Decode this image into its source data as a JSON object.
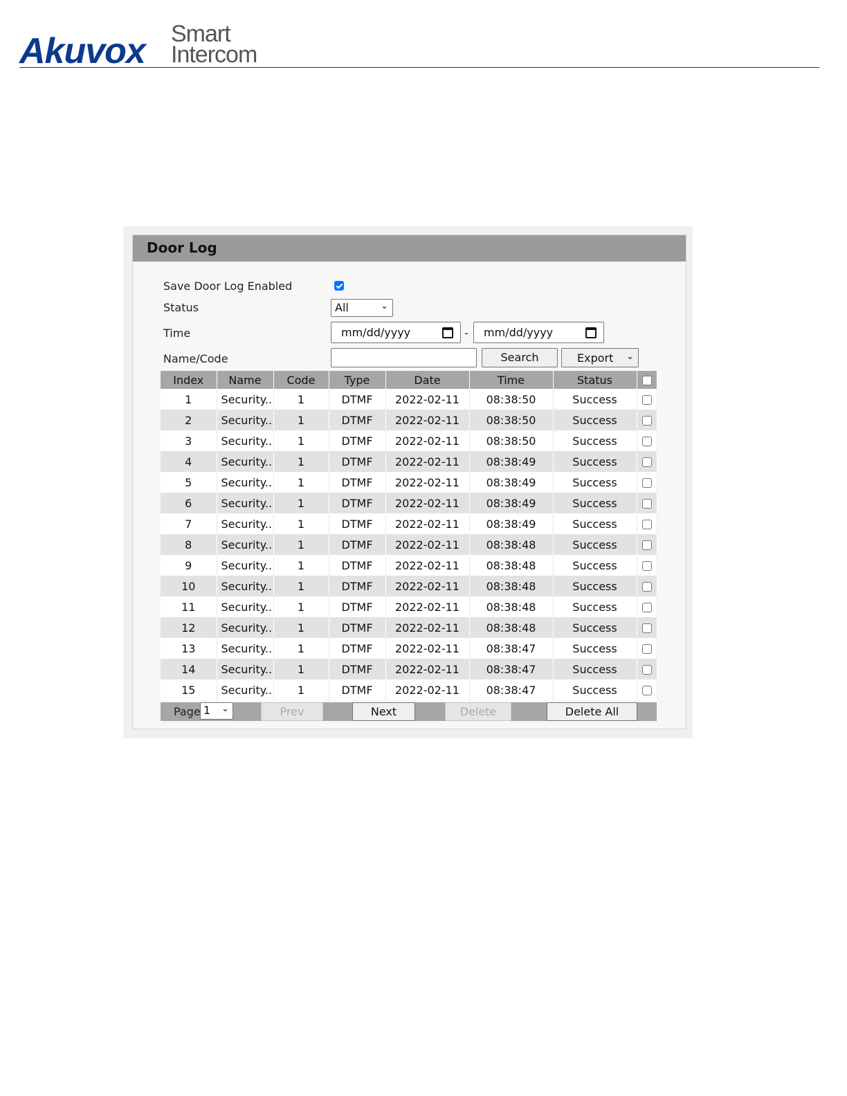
{
  "header": {
    "brand": "Akuvox",
    "tag_line1": "Smart",
    "tag_line2": "Intercom"
  },
  "panel": {
    "title": "Door Log"
  },
  "form": {
    "save_label": "Save Door Log Enabled",
    "save_checked": true,
    "status_label": "Status",
    "status_value": "All",
    "time_label": "Time",
    "date_from_placeholder": "mm/dd/yyyy",
    "date_separator": "-",
    "date_to_placeholder": "mm/dd/yyyy",
    "name_code_label": "Name/Code",
    "name_code_value": "",
    "search_label": "Search",
    "export_label": "Export"
  },
  "table": {
    "headers": [
      "Index",
      "Name",
      "Code",
      "Type",
      "Date",
      "Time",
      "Status"
    ],
    "rows": [
      {
        "index": "1",
        "name": "Security..",
        "code": "1",
        "type": "DTMF",
        "date": "2022-02-11",
        "time": "08:38:50",
        "status": "Success"
      },
      {
        "index": "2",
        "name": "Security..",
        "code": "1",
        "type": "DTMF",
        "date": "2022-02-11",
        "time": "08:38:50",
        "status": "Success"
      },
      {
        "index": "3",
        "name": "Security..",
        "code": "1",
        "type": "DTMF",
        "date": "2022-02-11",
        "time": "08:38:50",
        "status": "Success"
      },
      {
        "index": "4",
        "name": "Security..",
        "code": "1",
        "type": "DTMF",
        "date": "2022-02-11",
        "time": "08:38:49",
        "status": "Success"
      },
      {
        "index": "5",
        "name": "Security..",
        "code": "1",
        "type": "DTMF",
        "date": "2022-02-11",
        "time": "08:38:49",
        "status": "Success"
      },
      {
        "index": "6",
        "name": "Security..",
        "code": "1",
        "type": "DTMF",
        "date": "2022-02-11",
        "time": "08:38:49",
        "status": "Success"
      },
      {
        "index": "7",
        "name": "Security..",
        "code": "1",
        "type": "DTMF",
        "date": "2022-02-11",
        "time": "08:38:49",
        "status": "Success"
      },
      {
        "index": "8",
        "name": "Security..",
        "code": "1",
        "type": "DTMF",
        "date": "2022-02-11",
        "time": "08:38:48",
        "status": "Success"
      },
      {
        "index": "9",
        "name": "Security..",
        "code": "1",
        "type": "DTMF",
        "date": "2022-02-11",
        "time": "08:38:48",
        "status": "Success"
      },
      {
        "index": "10",
        "name": "Security..",
        "code": "1",
        "type": "DTMF",
        "date": "2022-02-11",
        "time": "08:38:48",
        "status": "Success"
      },
      {
        "index": "11",
        "name": "Security..",
        "code": "1",
        "type": "DTMF",
        "date": "2022-02-11",
        "time": "08:38:48",
        "status": "Success"
      },
      {
        "index": "12",
        "name": "Security..",
        "code": "1",
        "type": "DTMF",
        "date": "2022-02-11",
        "time": "08:38:48",
        "status": "Success"
      },
      {
        "index": "13",
        "name": "Security..",
        "code": "1",
        "type": "DTMF",
        "date": "2022-02-11",
        "time": "08:38:47",
        "status": "Success"
      },
      {
        "index": "14",
        "name": "Security..",
        "code": "1",
        "type": "DTMF",
        "date": "2022-02-11",
        "time": "08:38:47",
        "status": "Success"
      },
      {
        "index": "15",
        "name": "Security..",
        "code": "1",
        "type": "DTMF",
        "date": "2022-02-11",
        "time": "08:38:47",
        "status": "Success"
      }
    ]
  },
  "pagination": {
    "page_label": "Page",
    "page_value": "1",
    "prev_label": "Prev",
    "next_label": "Next",
    "delete_label": "Delete",
    "delete_all_label": "Delete All"
  },
  "colors": {
    "brand": "#0b3a8c",
    "title_bar": "#9a9a9a",
    "header_row": "#a6a6a6",
    "alt_row": "#e2e2e2",
    "checkbox_checked": "#0075ff"
  },
  "icons": {
    "chevron": "chevron-down-icon",
    "calendar": "calendar-icon",
    "checkbox": "checkbox-icon"
  }
}
